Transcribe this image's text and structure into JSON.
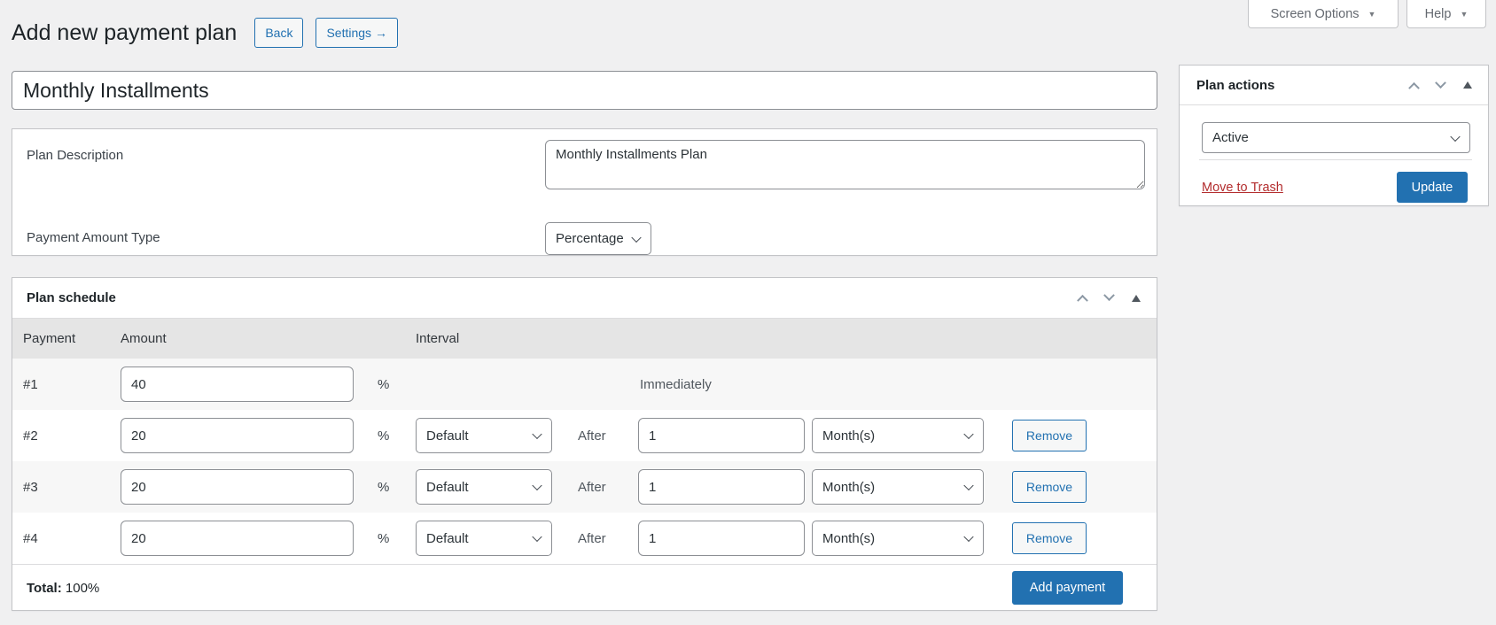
{
  "header": {
    "title": "Add new payment plan",
    "back": "Back",
    "settings": "Settings →"
  },
  "top_tabs": {
    "screen_options": "Screen Options",
    "help": "Help",
    "caret": "▼"
  },
  "plan": {
    "title_value": "Monthly Installments",
    "description_label": "Plan Description",
    "description_value": "Monthly Installments Plan",
    "amount_type_label": "Payment Amount Type",
    "amount_type_value": "Percentage"
  },
  "plan_actions": {
    "title": "Plan actions",
    "status_value": "Active",
    "move_to_trash": "Move to Trash",
    "update": "Update"
  },
  "schedule": {
    "title": "Plan schedule",
    "col_payment": "Payment",
    "col_amount": "Amount",
    "col_interval": "Interval",
    "percent": "%",
    "after": "After",
    "remove": "Remove",
    "rows": [
      {
        "id": "#1",
        "amount": "40",
        "interval": "Immediately"
      },
      {
        "id": "#2",
        "amount": "20",
        "type": "Default",
        "after_value": "1",
        "unit": "Month(s)"
      },
      {
        "id": "#3",
        "amount": "20",
        "type": "Default",
        "after_value": "1",
        "unit": "Month(s)"
      },
      {
        "id": "#4",
        "amount": "20",
        "type": "Default",
        "after_value": "1",
        "unit": "Month(s)"
      }
    ],
    "total_label": "Total:",
    "total_value": "100%",
    "add_payment": "Add payment"
  },
  "colors": {
    "accent_blue": "#2271b1",
    "trash_red": "#b32d2e",
    "page_bg": "#f0f0f1"
  }
}
